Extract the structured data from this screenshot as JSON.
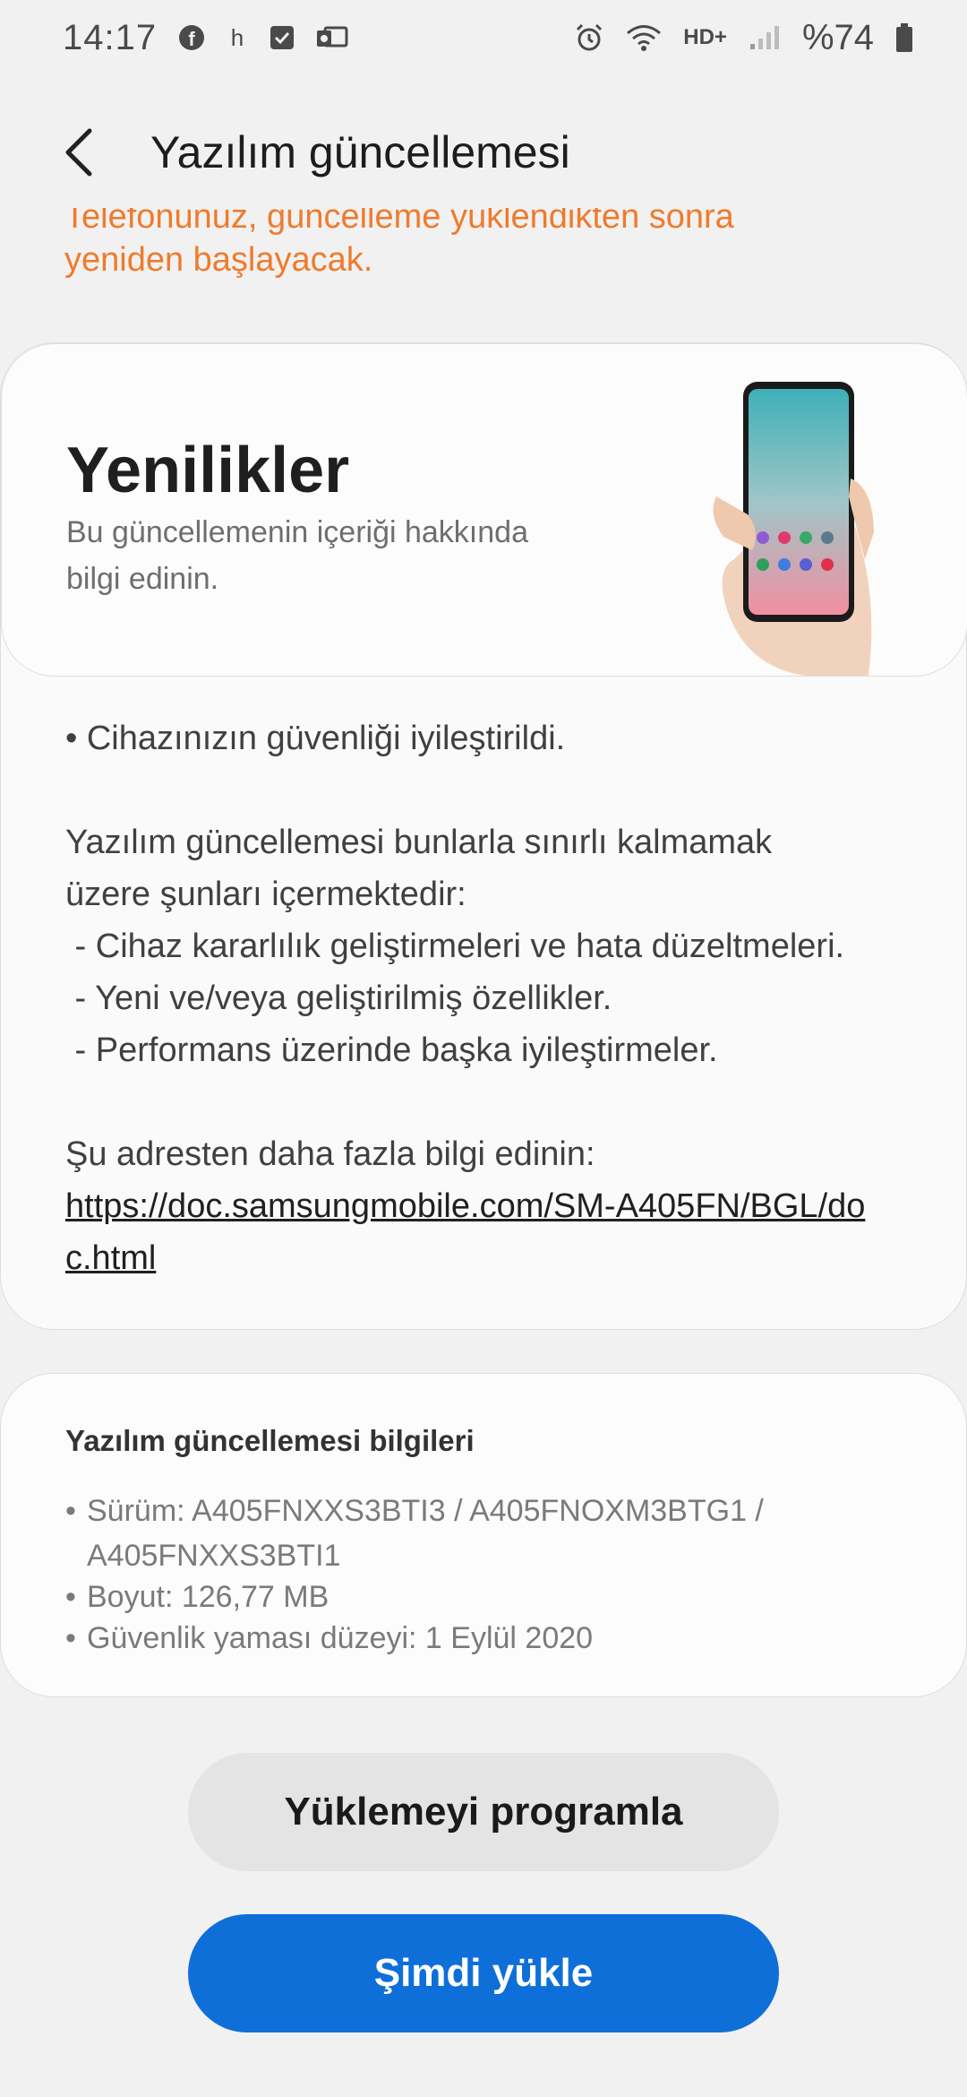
{
  "status_bar": {
    "time": "14:17",
    "left_icons": [
      "facebook-icon",
      "h-icon",
      "checkbox-icon",
      "outlook-icon"
    ],
    "network_label": "HD+",
    "battery_text": "%74"
  },
  "header": {
    "title": "Yazılım güncellemesi"
  },
  "warning": {
    "line1": "Telefonunuz, güncelleme yüklendikten sonra",
    "line2": "yeniden başlayacak.",
    "color": "#ef7b2c"
  },
  "news": {
    "title": "Yenilikler",
    "subtitle": "Bu güncellemenin içeriği hakkında bilgi edinin.",
    "bullet": "• Cihazınızın güvenliği iyileştirildi.",
    "paragraph_line1": "Yazılım güncellemesi bunlarla sınırlı kalmamak",
    "paragraph_line2": "üzere şunları içermektedir:",
    "items": [
      " - Cihaz kararlılık geliştirmeleri ve hata düzeltmeleri.",
      " - Yeni ve/veya geliştirilmiş özellikler.",
      " - Performans üzerinde başka iyileştirmeler."
    ],
    "more_info": "Şu adresten daha fazla bilgi edinin:",
    "link": "https://doc.samsungmobile.com/SM-A405FN/BGL/doc.html"
  },
  "info": {
    "title": "Yazılım güncellemesi bilgileri",
    "version": "Sürüm: A405FNXXS3BTI3 / A405FNOXM3BTG1 / A405FNXXS3BTI1",
    "size": "Boyut: 126,77 MB",
    "security_patch": "Güvenlik yaması düzeyi: 1 Eylül 2020"
  },
  "buttons": {
    "schedule": "Yüklemeyi programla",
    "install": "Şimdi yükle"
  },
  "colors": {
    "accent": "#0f6fd9",
    "warning": "#ef7b2c",
    "background": "#f1f1f1"
  }
}
